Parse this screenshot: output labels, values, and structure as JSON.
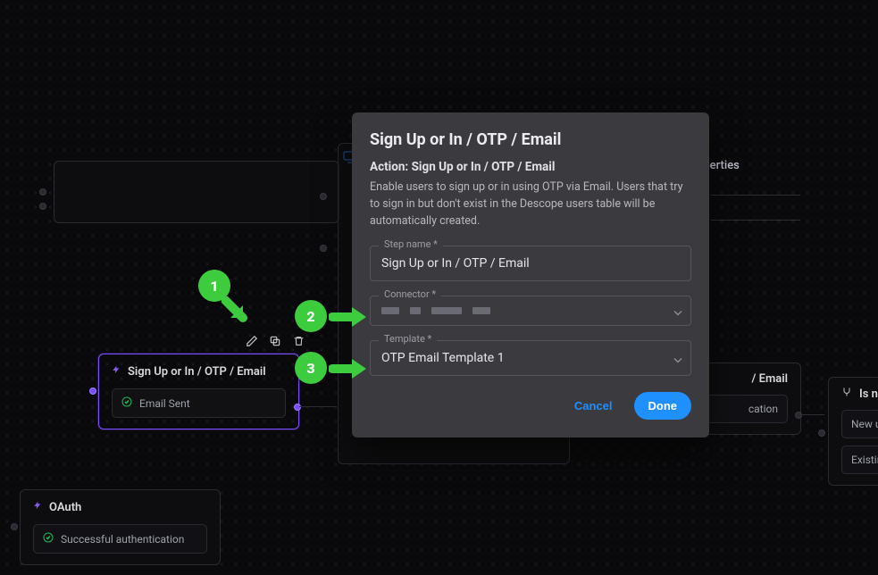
{
  "modal": {
    "title": "Sign Up or In / OTP / Email",
    "action_prefix": "Action: ",
    "action_name": "Sign Up or In / OTP / Email",
    "description": "Enable users to sign up or in using OTP via Email. Users that try to sign in but don't exist in the Descope users table will be automatically created.",
    "fields": {
      "step_name": {
        "label": "Step name *",
        "value": "Sign Up or In / OTP / Email"
      },
      "connector": {
        "label": "Connector *"
      },
      "template": {
        "label": "Template *",
        "value": "OTP Email Template 1"
      }
    },
    "cancel": "Cancel",
    "done": "Done"
  },
  "nodes": {
    "selected": {
      "title": "Sign Up or In / OTP / Email",
      "sub": "Email Sent"
    },
    "oauth": {
      "title": "OAuth",
      "sub": "Successful authentication"
    },
    "right1": {
      "title_fragment": "/ Email",
      "sub_fragment": "cation",
      "properties_fragment": "operties"
    },
    "isnew": {
      "title": "Is new",
      "row1": "New use",
      "row2": "Existing"
    }
  },
  "annotations": {
    "b1": "1",
    "b2": "2",
    "b3": "3"
  }
}
